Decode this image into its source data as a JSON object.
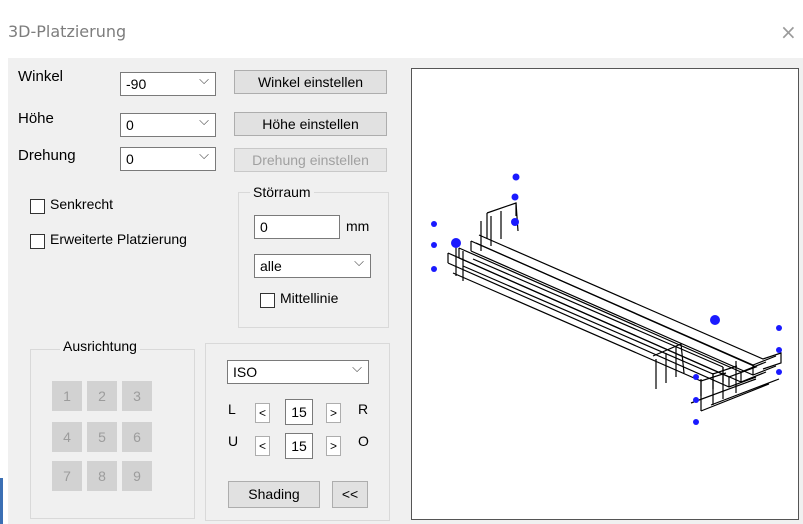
{
  "window": {
    "title": "3D-Platzierung",
    "close_glyph": "×"
  },
  "fields": {
    "winkel": {
      "label": "Winkel",
      "value": "-90",
      "button": "Winkel einstellen"
    },
    "hoehe": {
      "label": "Höhe",
      "value": "0",
      "button": "Höhe einstellen"
    },
    "drehung": {
      "label": "Drehung",
      "value": "0",
      "button": "Drehung einstellen"
    }
  },
  "checkboxes": {
    "senkrecht": "Senkrecht",
    "erweitert": "Erweiterte Platzierung"
  },
  "stoerraum": {
    "title": "Störraum",
    "value": "0",
    "unit": "mm",
    "select": "alle",
    "mittellinie": "Mittellinie"
  },
  "ausrichtung": {
    "title": "Ausrichtung",
    "cells": [
      "1",
      "2",
      "3",
      "4",
      "5",
      "6",
      "7",
      "8",
      "9"
    ]
  },
  "view": {
    "mode": "ISO",
    "row1": {
      "left_label": "L",
      "value": "15",
      "right_label": "R"
    },
    "row2": {
      "left_label": "U",
      "value": "15",
      "right_label": "O"
    },
    "dec": "<",
    "inc": ">",
    "shading": "Shading",
    "collapse": "<<"
  },
  "colors": {
    "handle": "#1a1aff",
    "disabled_text": "#a0a0a0",
    "panel": "#f0f0f0"
  }
}
